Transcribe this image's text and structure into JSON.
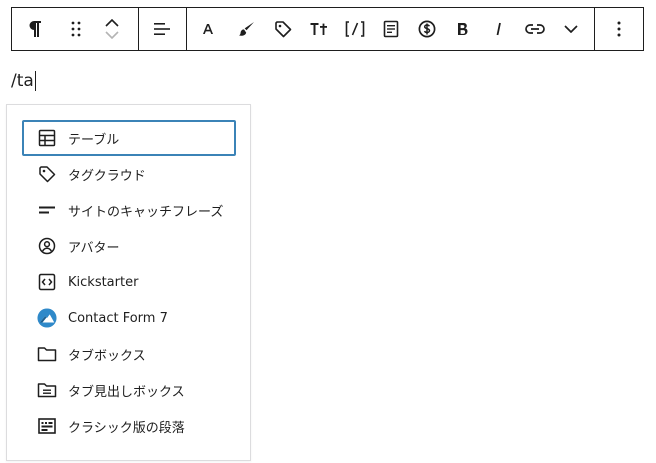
{
  "toolbar": {
    "groups": [
      {
        "buttons": [
          {
            "name": "paragraph-icon",
            "label": "Paragraph"
          },
          {
            "name": "drag-handle-icon",
            "label": "Drag"
          },
          {
            "name": "move-up-down-icon",
            "label": "Move"
          }
        ]
      },
      {
        "buttons": [
          {
            "name": "align-left-icon",
            "label": "Align"
          }
        ]
      },
      {
        "buttons": [
          {
            "name": "font-a-icon",
            "label": "A"
          },
          {
            "name": "brush-icon",
            "label": "Highlight"
          },
          {
            "name": "tag-icon",
            "label": "Tag"
          },
          {
            "name": "font-size-icon",
            "label": "Tt"
          },
          {
            "name": "shortcode-icon",
            "label": "[/]"
          },
          {
            "name": "document-icon",
            "label": "Document"
          },
          {
            "name": "dollar-circle-icon",
            "label": "Price"
          },
          {
            "name": "bold-icon",
            "label": "B"
          },
          {
            "name": "italic-icon",
            "label": "I"
          },
          {
            "name": "link-icon",
            "label": "Link"
          },
          {
            "name": "chevron-down-icon",
            "label": "More"
          }
        ]
      },
      {
        "buttons": [
          {
            "name": "more-options-icon",
            "label": "Options"
          }
        ]
      }
    ]
  },
  "editor": {
    "command_text": "/ta"
  },
  "menu": {
    "items": [
      {
        "label": "テーブル",
        "icon": "table-icon",
        "selected": true
      },
      {
        "label": "タグクラウド",
        "icon": "tag-icon"
      },
      {
        "label": "サイトのキャッチフレーズ",
        "icon": "tagline-icon"
      },
      {
        "label": "アバター",
        "icon": "avatar-icon"
      },
      {
        "label": "Kickstarter",
        "icon": "code-box-icon"
      },
      {
        "label": "Contact Form 7",
        "icon": "contact-form-7-icon"
      },
      {
        "label": "タブボックス",
        "icon": "folder-icon"
      },
      {
        "label": "タブ見出しボックス",
        "icon": "folder-doc-icon"
      },
      {
        "label": "クラシック版の段落",
        "icon": "classic-paragraph-icon"
      }
    ]
  },
  "colors": {
    "selected_border": "#3b83b7",
    "text": "#1e1e1e",
    "popover_border": "#dcdcde"
  }
}
